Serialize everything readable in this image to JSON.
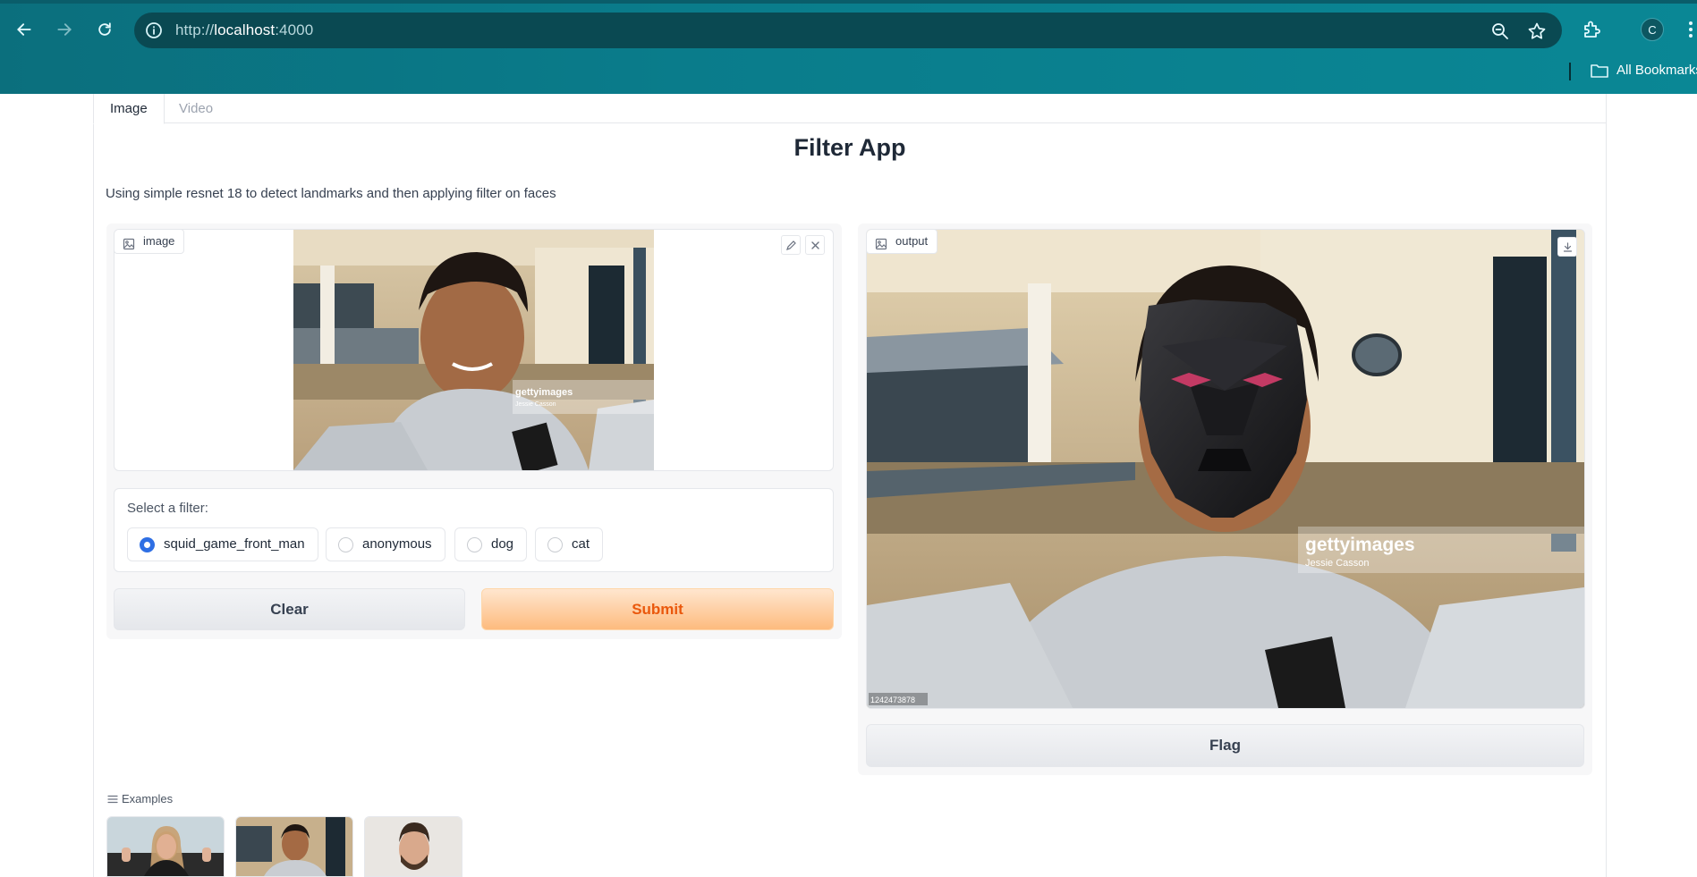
{
  "browser": {
    "url_scheme": "http://",
    "url_host": "localhost",
    "url_port": ":4000",
    "profile_initial": "C",
    "bookmarks_label": "All Bookmarks"
  },
  "tabs": [
    {
      "label": "Image",
      "active": true
    },
    {
      "label": "Video",
      "active": false
    }
  ],
  "app": {
    "title": "Filter App",
    "description": "Using simple resnet 18 to detect landmarks and then applying filter on faces"
  },
  "input_image": {
    "label": "image",
    "watermark_brand": "gettyimages",
    "watermark_credit": "Jessie Casson"
  },
  "filter": {
    "label": "Select a filter:",
    "options": [
      {
        "label": "squid_game_front_man",
        "checked": true
      },
      {
        "label": "anonymous",
        "checked": false
      },
      {
        "label": "dog",
        "checked": false
      },
      {
        "label": "cat",
        "checked": false
      }
    ]
  },
  "buttons": {
    "clear": "Clear",
    "submit": "Submit",
    "flag": "Flag"
  },
  "output_image": {
    "label": "output",
    "watermark_brand": "gettyimages",
    "watermark_credit": "Jessie Casson",
    "image_id": "1242473878"
  },
  "examples": {
    "label": "Examples",
    "count": 3
  },
  "colors": {
    "chrome": "#0a7c8b",
    "accent_orange": "#ea580c",
    "radio_checked": "#2f6fe4"
  }
}
